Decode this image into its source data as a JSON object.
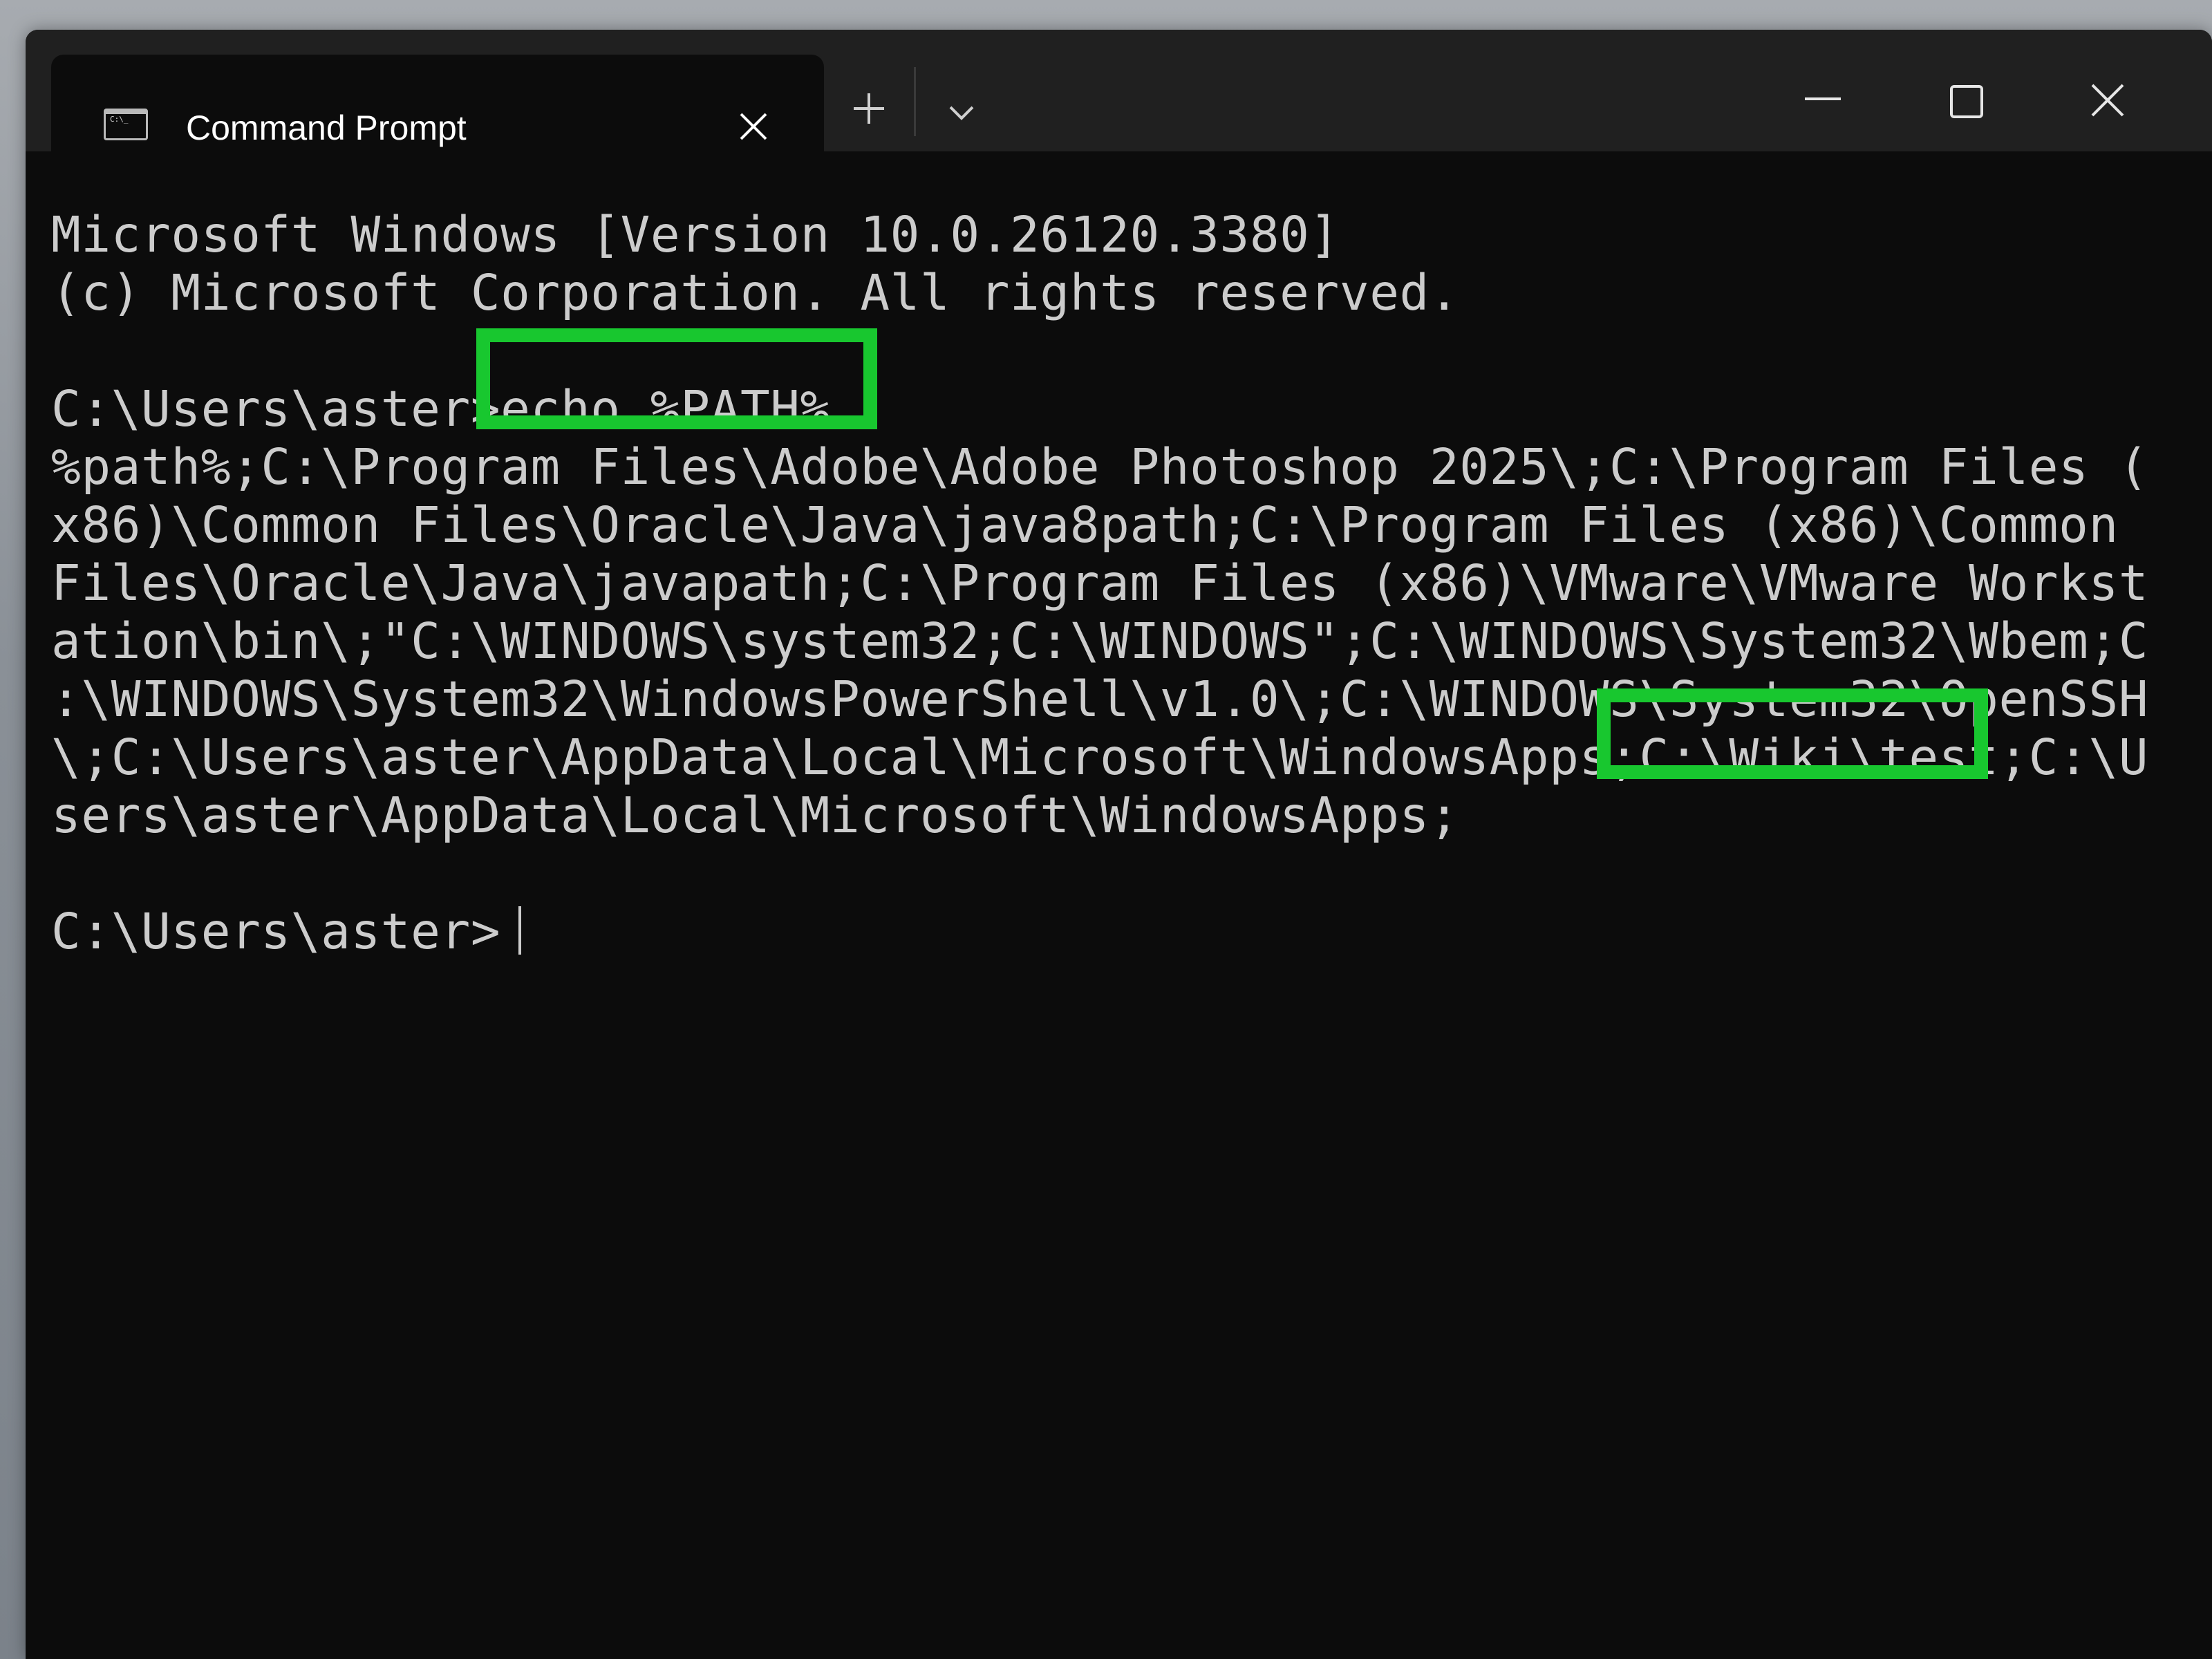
{
  "window": {
    "tab_title": "Command Prompt",
    "tab_icon_text": "C:\\_",
    "buttons": {
      "close_tab": "close-icon",
      "new_tab": "plus-icon",
      "dropdown": "chevron-down-icon",
      "minimize": "minimize-icon",
      "maximize": "maximize-icon",
      "close_window": "close-icon"
    }
  },
  "terminal": {
    "lines": [
      "Microsoft Windows [Version 10.0.26120.3380]",
      "(c) Microsoft Corporation. All rights reserved.",
      "",
      "C:\\Users\\aster>echo %PATH%",
      "%path%;C:\\Program Files\\Adobe\\Adobe Photoshop 2025\\;C:\\Program Files (",
      "x86)\\Common Files\\Oracle\\Java\\java8path;C:\\Program Files (x86)\\Common",
      "Files\\Oracle\\Java\\javapath;C:\\Program Files (x86)\\VMware\\VMware Workst",
      "ation\\bin\\;\"C:\\WINDOWS\\system32;C:\\WINDOWS\";C:\\WINDOWS\\System32\\Wbem;C",
      ":\\WINDOWS\\System32\\WindowsPowerShell\\v1.0\\;C:\\WINDOWS\\System32\\OpenSSH",
      "\\;C:\\Users\\aster\\AppData\\Local\\Microsoft\\WindowsApps;C:\\Wiki\\test;C:\\U",
      "sers\\aster\\AppData\\Local\\Microsoft\\WindowsApps;",
      "",
      "C:\\Users\\aster>"
    ]
  },
  "colors": {
    "highlight": "#18c72f",
    "terminal_bg": "#0c0c0c",
    "terminal_text": "#cccccc",
    "titlebar_bg": "#202020"
  }
}
